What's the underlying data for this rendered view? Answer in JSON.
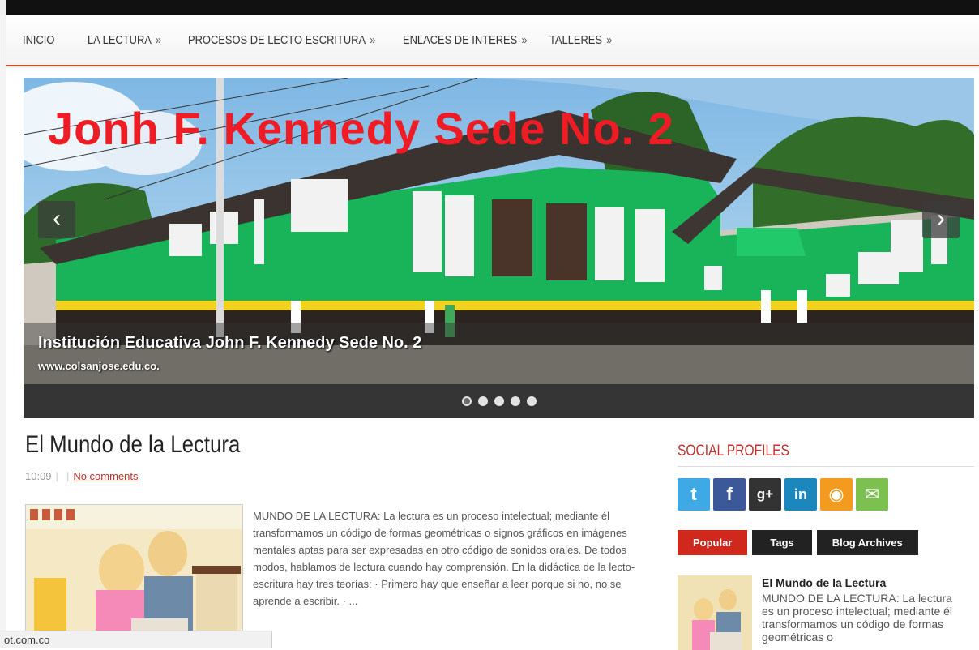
{
  "nav": {
    "items": [
      {
        "label": "INICIO",
        "arrow": ""
      },
      {
        "label": "LA LECTURA",
        "arrow": "»"
      },
      {
        "label": "PROCESOS DE LECTO ESCRITURA",
        "arrow": "»"
      },
      {
        "label": "ENLACES DE INTERES",
        "arrow": "»"
      },
      {
        "label": "TALLERES",
        "arrow": "»"
      }
    ]
  },
  "slider": {
    "overlay_title": "Jonh F. Kennedy Sede No. 2",
    "caption_title": "Institución Educativa John F. Kennedy Sede No. 2",
    "caption_sub": "www.colsanjose.edu.co.",
    "prev_icon": "‹",
    "next_icon": "›",
    "dot_count": 5,
    "active_dot": 1
  },
  "post": {
    "title": "El Mundo de la Lectura",
    "time": "10:09",
    "sep1": "|",
    "sep2": "|",
    "comments": "No comments",
    "excerpt": "MUNDO DE LA LECTURA: La lectura es un proceso intelectual; mediante él transformamos un código de formas geométricas o signos gráficos en imágenes mentales aptas para ser expresadas en otro código de sonidos orales. De todos modos, hablamos de lectura cuando hay comprensión. En la didáctica de la lecto-escritura hay tres teorías: · Primero hay que enseñar a leer porque si no, no se aprende a escribir. · ..."
  },
  "sidebar": {
    "social_title": "SOCIAL PROFILES",
    "social": [
      {
        "name": "twitter-icon",
        "glyph": "t",
        "color": "#3fa9e6"
      },
      {
        "name": "facebook-icon",
        "glyph": "f",
        "color": "#3b5998"
      },
      {
        "name": "google-plus-icon",
        "glyph": "g+",
        "color": "#333333"
      },
      {
        "name": "linkedin-icon",
        "glyph": "in",
        "color": "#1c87bd"
      },
      {
        "name": "rss-icon",
        "glyph": "◉",
        "color": "#f49a1e"
      },
      {
        "name": "email-icon",
        "glyph": "✉",
        "color": "#7cc04f"
      }
    ],
    "tabs": [
      "Popular",
      "Tags",
      "Blog Archives"
    ],
    "popular": {
      "title": "El Mundo de la Lectura",
      "text": "MUNDO DE LA LECTURA: La lectura es un proceso intelectual; mediante él transformamos un código de formas geométricas o"
    }
  },
  "status": {
    "text": "ot.com.co"
  }
}
